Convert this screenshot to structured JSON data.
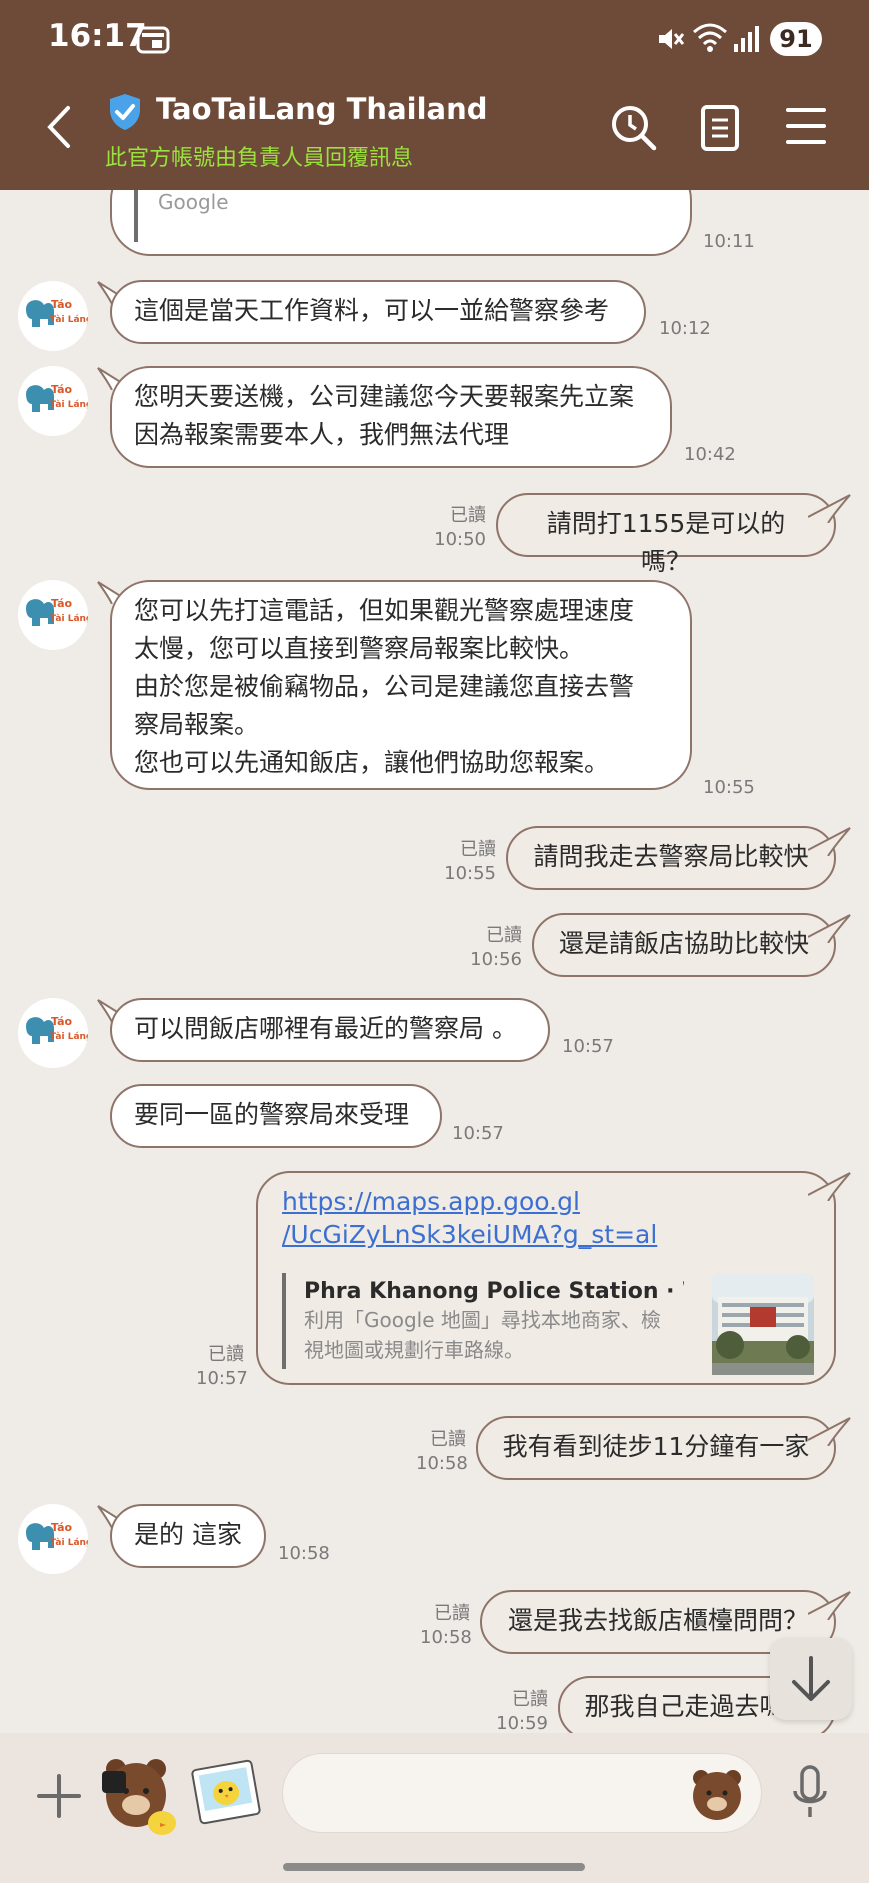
{
  "status": {
    "time": "16:17",
    "battery": "91"
  },
  "header": {
    "title": "TaoTaiLang Thailand",
    "subtitle": "此官方帳號由負責人員回覆訊息"
  },
  "messages": {
    "m0": {
      "text": "Find out more about 巧克力村 by following them on\nGoogle",
      "time": "10:11"
    },
    "m1": {
      "text": "這個是當天工作資料，可以一並給警察參考",
      "time": "10:12"
    },
    "m2": {
      "text": "您明天要送機，公司建議您今天要報案先立案\n因為報案需要本人，我們無法代理",
      "time": "10:42"
    },
    "m3": {
      "text": "請問打1155是可以的嗎？",
      "time": "10:50",
      "read": "已讀"
    },
    "m4": {
      "text": "您可以先打這電話，但如果觀光警察處理速度\n太慢，您可以直接到警察局報案比較快。\n由於您是被偷竊物品，公司是建議您直接去警\n察局報案。\n您也可以先通知飯店，讓他們協助您報案。",
      "time": "10:55"
    },
    "m5": {
      "text": "請問我走去警察局比較快",
      "time": "10:55",
      "read": "已讀"
    },
    "m6": {
      "text": "還是請飯店協助比較快",
      "time": "10:56",
      "read": "已讀"
    },
    "m7": {
      "text": "可以問飯店哪裡有最近的警察局 。",
      "time": "10:57"
    },
    "m8": {
      "text": "要同一區的警察局來受理",
      "time": "10:57"
    },
    "m9": {
      "url": "https://maps.app.goo.gl\n/UcGiZyLnSk3keiUMA?g_st=al",
      "preview_title": "Phra Khanong Police Station · Wat...",
      "preview_desc": "利用「Google 地圖」尋找本地商家、檢\n視地圖或規劃行車路線。",
      "time": "10:57",
      "read": "已讀"
    },
    "m10": {
      "text": "我有看到徒步11分鐘有一家",
      "time": "10:58",
      "read": "已讀"
    },
    "m11": {
      "text": "是的 這家",
      "time": "10:58"
    },
    "m12": {
      "text": "還是我去找飯店櫃檯問問？",
      "time": "10:58",
      "read": "已讀"
    },
    "m13": {
      "text": "那我自己走過去嗎？",
      "time": "10:59",
      "read": "已讀"
    }
  },
  "avatar": {
    "line1": "Táo",
    "line2": "Tài Láng"
  },
  "colors": {
    "header": "#6e4a39",
    "chat_bg": "#efebe6",
    "subtitle": "#9be23c",
    "link": "#3b6fd1"
  }
}
